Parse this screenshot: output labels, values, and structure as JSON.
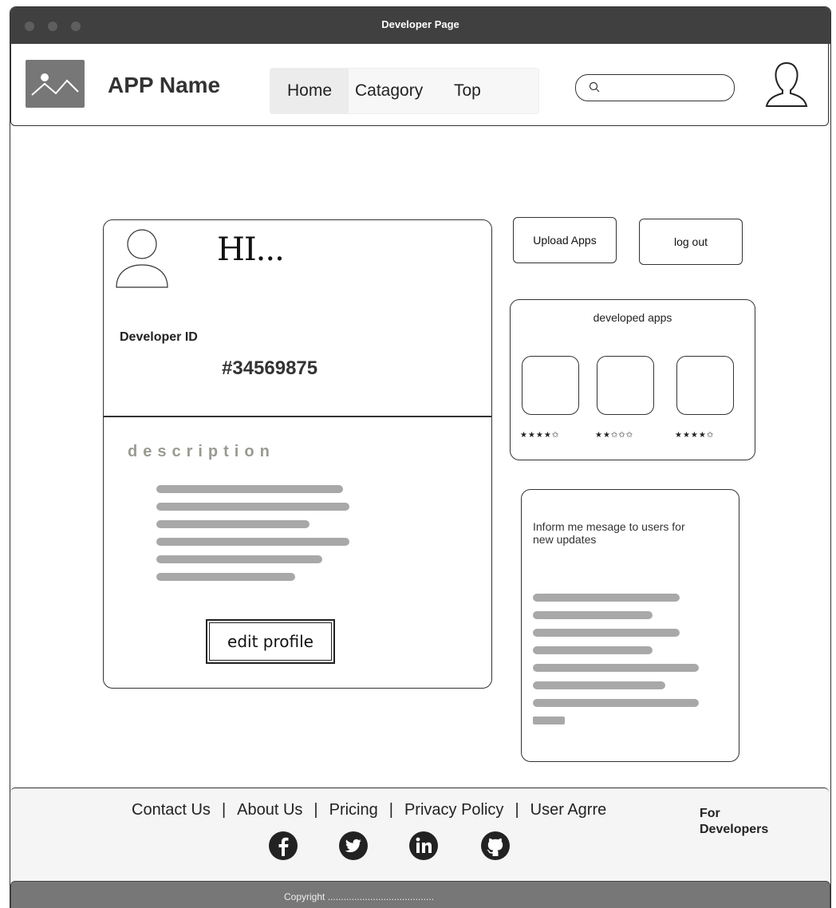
{
  "window": {
    "title": "Developer Page"
  },
  "header": {
    "app_name": "APP Name",
    "nav": [
      "Home",
      "Catagory",
      "Top"
    ],
    "search_placeholder": ""
  },
  "profile": {
    "greeting": "HI...",
    "developer_id_label": "Developer ID",
    "developer_id": "#34569875",
    "description_title": "description",
    "edit_button": "edit profile"
  },
  "actions": {
    "upload": "Upload Apps",
    "logout": "log out"
  },
  "developed_apps": {
    "label": "developed apps",
    "ratings": [
      4,
      2,
      4
    ],
    "ratings_text": [
      "★★★★✩",
      "★★✩✩✩",
      "★★★★✩"
    ]
  },
  "inform": {
    "text": "Inform me mesage to users for new updates"
  },
  "footer": {
    "links": [
      "Contact Us",
      "About Us",
      "Pricing",
      "Privacy Policy",
      "User Agrre"
    ],
    "for_developers": "For Developers",
    "social": [
      "facebook-icon",
      "twitter-icon",
      "linkedin-icon",
      "github-icon"
    ],
    "copyright": "Copyright ........................................"
  }
}
